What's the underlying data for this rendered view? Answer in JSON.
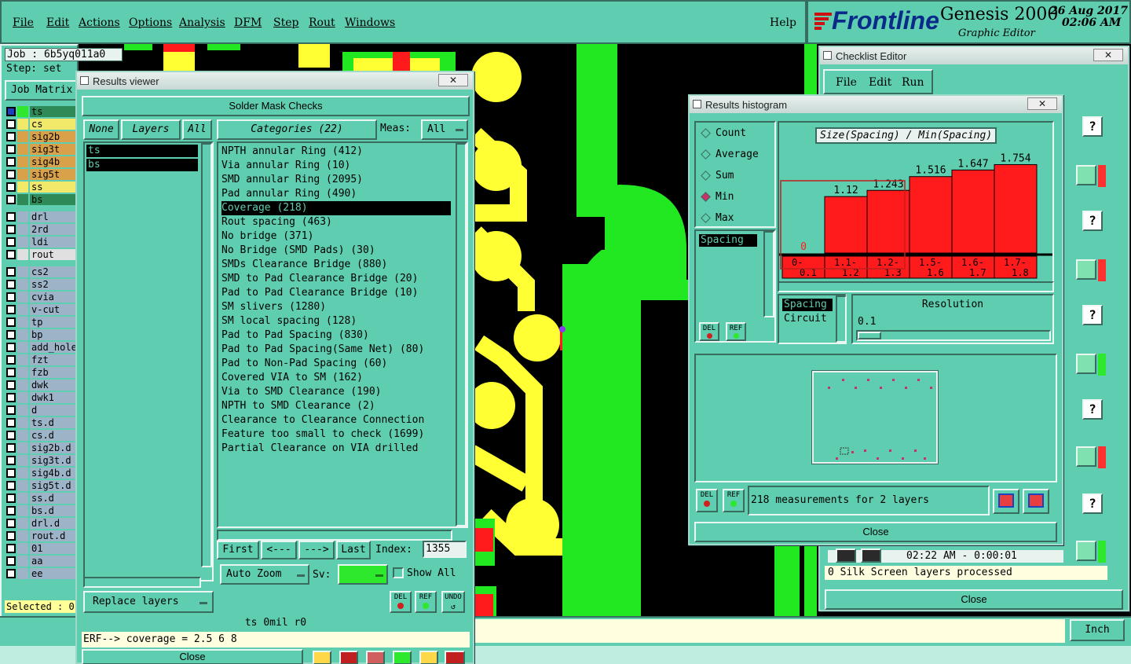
{
  "menubar": {
    "items": [
      "File",
      "Edit",
      "Actions",
      "Options",
      "Analysis",
      "DFM",
      "Step",
      "Rout",
      "Windows"
    ],
    "help": "Help"
  },
  "brand": {
    "logo": "Frontline",
    "product": "Genesis 2000",
    "subtitle": "Graphic Editor",
    "date": "26 Aug 2017",
    "time": "02:06 AM"
  },
  "job": {
    "job_label": "Job : 6b5yq011a0",
    "step_label": "Step: set",
    "matrix_button": "Job Matrix"
  },
  "layers": [
    {
      "name": "ts",
      "color": "#2e8b57",
      "tag": "#2de82d",
      "sel": true
    },
    {
      "name": "cs",
      "color": "#f2e86a",
      "tag": "#f2e86a"
    },
    {
      "name": "sig2b",
      "color": "#d9a24a",
      "tag": "#d9a24a"
    },
    {
      "name": "sig3t",
      "color": "#d9a24a",
      "tag": "#d9a24a"
    },
    {
      "name": "sig4b",
      "color": "#d9a24a",
      "tag": "#d9a24a"
    },
    {
      "name": "sig5t",
      "color": "#d9a24a",
      "tag": "#d9a24a"
    },
    {
      "name": "ss",
      "color": "#f2e86a",
      "tag": "#f2e86a"
    },
    {
      "name": "bs",
      "color": "#2e8b57",
      "tag": "#2e8b57",
      "sel": true
    },
    {
      "name": "drl",
      "color": "#9db3c8",
      "tag": "#9db3c8"
    },
    {
      "name": "2rd",
      "color": "#9db3c8",
      "tag": "#9db3c8"
    },
    {
      "name": "ldi",
      "color": "#9db3c8",
      "tag": "#9db3c8"
    },
    {
      "name": "rout",
      "color": "#e0e0e0",
      "tag": "#e0e0e0"
    },
    {
      "name": "cs2",
      "color": "#9db3c8",
      "tag": "#9db3c8"
    },
    {
      "name": "ss2",
      "color": "#9db3c8",
      "tag": "#9db3c8"
    },
    {
      "name": "cvia",
      "color": "#9db3c8",
      "tag": "#9db3c8"
    },
    {
      "name": "v-cut",
      "color": "#9db3c8",
      "tag": "#9db3c8"
    },
    {
      "name": "tp",
      "color": "#9db3c8",
      "tag": "#9db3c8"
    },
    {
      "name": "bp",
      "color": "#9db3c8",
      "tag": "#9db3c8"
    },
    {
      "name": "add_hole",
      "color": "#9db3c8",
      "tag": "#9db3c8"
    },
    {
      "name": "fzt",
      "color": "#9db3c8",
      "tag": "#9db3c8"
    },
    {
      "name": "fzb",
      "color": "#9db3c8",
      "tag": "#9db3c8"
    },
    {
      "name": "dwk",
      "color": "#9db3c8",
      "tag": "#9db3c8"
    },
    {
      "name": "dwk1",
      "color": "#9db3c8",
      "tag": "#9db3c8"
    },
    {
      "name": "d",
      "color": "#9db3c8",
      "tag": "#9db3c8"
    },
    {
      "name": "ts.d",
      "color": "#9db3c8",
      "tag": "#9db3c8"
    },
    {
      "name": "cs.d",
      "color": "#9db3c8",
      "tag": "#9db3c8"
    },
    {
      "name": "sig2b.d",
      "color": "#9db3c8",
      "tag": "#9db3c8"
    },
    {
      "name": "sig3t.d",
      "color": "#9db3c8",
      "tag": "#9db3c8"
    },
    {
      "name": "sig4b.d",
      "color": "#9db3c8",
      "tag": "#9db3c8"
    },
    {
      "name": "sig5t.d",
      "color": "#9db3c8",
      "tag": "#9db3c8"
    },
    {
      "name": "ss.d",
      "color": "#9db3c8",
      "tag": "#9db3c8"
    },
    {
      "name": "bs.d",
      "color": "#9db3c8",
      "tag": "#9db3c8"
    },
    {
      "name": "drl.d",
      "color": "#9db3c8",
      "tag": "#9db3c8"
    },
    {
      "name": "rout.d",
      "color": "#9db3c8",
      "tag": "#9db3c8"
    },
    {
      "name": "01",
      "color": "#9db3c8",
      "tag": "#9db3c8"
    },
    {
      "name": "aa",
      "color": "#9db3c8",
      "tag": "#9db3c8"
    },
    {
      "name": "ee",
      "color": "#9db3c8",
      "tag": "#9db3c8"
    }
  ],
  "selected_label": "Selected : 0",
  "results_viewer": {
    "title": "Results viewer",
    "header": "Solder Mask Checks",
    "none_btn": "None",
    "layers_btn": "Layers",
    "all_btn": "All",
    "categories_btn": "Categories (22)",
    "meas_label": "Meas:",
    "meas_value": "All",
    "layer_items": [
      "ts",
      "bs"
    ],
    "categories": [
      "NPTH annular Ring (412)",
      "Via annular Ring (10)",
      "SMD annular Ring (2095)",
      "Pad annular Ring (490)",
      "Coverage (218)",
      "Rout spacing (463)",
      "No bridge (371)",
      "No Bridge (SMD Pads) (30)",
      "SMDs Clearance Bridge (880)",
      "SMD to Pad Clearance Bridge (20)",
      "Pad to Pad Clearance Bridge (10)",
      "SM slivers (1280)",
      "SM local spacing (128)",
      "Pad to Pad Spacing (830)",
      "Pad to Pad Spacing(Same Net) (80)",
      "Pad to Non-Pad Spacing (60)",
      "Covered VIA to SM (162)",
      "Via to SMD Clearance (190)",
      "NPTH to SMD Clearance (2)",
      "Clearance to Clearance Connection",
      "Feature too small to check (1699)",
      "Partial Clearance on VIA drilled"
    ],
    "selected_category": 4,
    "first_btn": "First",
    "prev_btn": "<---",
    "next_btn": "--->",
    "last_btn": "Last",
    "index_label": "Index:",
    "index_value": "1355",
    "auto_zoom": "Auto Zoom",
    "sv_label": "Sv:",
    "show_all": "Show All",
    "replace_layers": "Replace layers",
    "del": "DEL",
    "ref": "REF",
    "undo": "UNDO",
    "status": "ts 0mil   r0",
    "erf_line": "ERF--> coverage = 2.5 6 8",
    "close": "Close"
  },
  "histogram": {
    "title": "Results histogram",
    "options": [
      "Count",
      "Average",
      "Sum",
      "Min",
      "Max"
    ],
    "selected_option": "Min",
    "chart_title": "Size(Spacing) / Min(Spacing)",
    "spacing_item": "Spacing",
    "attr_items": [
      "Spacing",
      "Circuit"
    ],
    "resolution_label": "Resolution",
    "resolution_value": "0.1",
    "del": "DEL",
    "ref": "REF",
    "measurements": "218 measurements for 2 layers",
    "close": "Close"
  },
  "chart_data": {
    "type": "bar",
    "title": "Size(Spacing) / Min(Spacing)",
    "categories": [
      "0-\n0.1",
      "1.1-\n1.2",
      "1.2-\n1.3",
      "1.5-\n1.6",
      "1.6-\n1.7",
      "1.7-\n1.8"
    ],
    "values": [
      0,
      1.12,
      1.243,
      1.516,
      1.647,
      1.754
    ],
    "value_labels": [
      "0",
      "1.12",
      "1.243",
      "1.516",
      "1.647",
      "1.754"
    ],
    "ylim": [
      0,
      1.9
    ],
    "bar_color": "#ff1b1b"
  },
  "checklist": {
    "title": "Checklist Editor",
    "menu": [
      "File",
      "Edit",
      "Run"
    ],
    "time_line": "02:22 AM - 0:00:01",
    "log_line": "0 Silk Screen layers processed",
    "close": "Close"
  },
  "bottom": {
    "unit": "Inch"
  }
}
